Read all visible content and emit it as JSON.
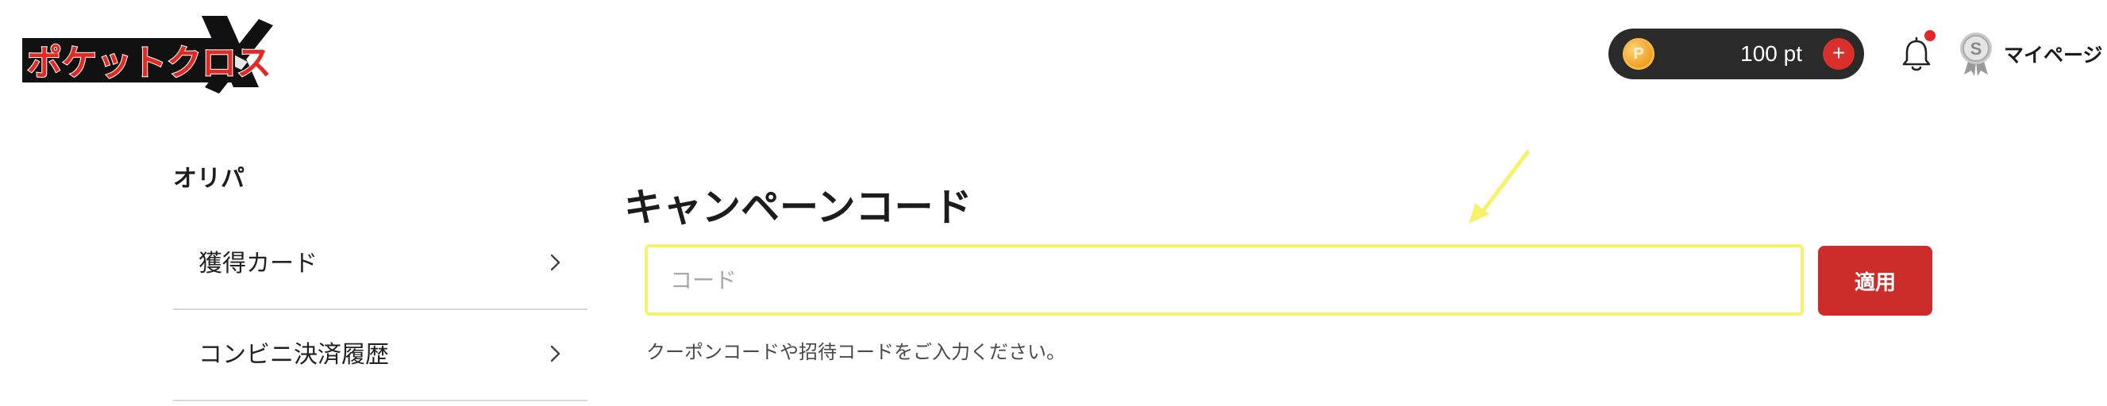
{
  "header": {
    "logo_text": "ポケットクロス",
    "points": {
      "coin_symbol": "P",
      "value": "100 pt",
      "add_symbol": "+"
    },
    "notification": {
      "has_unread": true
    },
    "mypage": {
      "badge_letter": "S",
      "label": "マイページ"
    }
  },
  "sidebar": {
    "heading": "オリパ",
    "items": [
      {
        "label": "獲得カード"
      },
      {
        "label": "コンビニ決済履歴"
      }
    ]
  },
  "main": {
    "title": "キャンペーンコード",
    "code_input": {
      "placeholder": "コード",
      "value": ""
    },
    "apply_label": "適用",
    "help_text": "クーポンコードや招待コードをご入力ください。"
  },
  "colors": {
    "accent_red": "#cc2d2a",
    "pill_dark": "#2a2a2a",
    "highlight_yellow": "#f6f26a",
    "coin_gold": "#f2a62c"
  },
  "icons": {
    "coin": "coin-icon",
    "add": "plus-icon",
    "bell": "bell-icon",
    "badge": "rank-badge-icon",
    "chevron": "chevron-right-icon",
    "arrow": "annotation-arrow-icon"
  }
}
